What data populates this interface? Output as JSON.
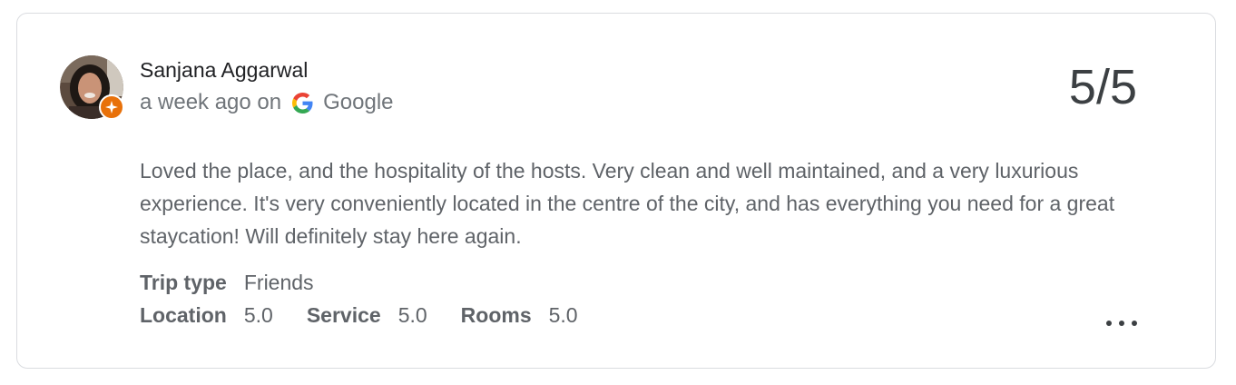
{
  "review": {
    "reviewer_name": "Sanjana Aggarwal",
    "time_ago": "a week ago on",
    "source": "Google",
    "score": "5/5",
    "text": "Loved the place, and the hospitality of the hosts. Very clean and well maintained, and a very luxurious experience. It's very conveniently located in the centre of the city, and has everything you need for a great staycation! Will definitely stay here again.",
    "trip_type_label": "Trip type",
    "trip_type_value": "Friends",
    "ratings": [
      {
        "label": "Location",
        "value": "5.0"
      },
      {
        "label": "Service",
        "value": "5.0"
      },
      {
        "label": "Rooms",
        "value": "5.0"
      }
    ]
  },
  "icons": {
    "avatar": "reviewer-avatar",
    "badge": "local-guide-badge-icon",
    "source_logo": "google-g-icon",
    "more": "more-options-icon"
  },
  "colors": {
    "badge": "#e8710a",
    "score_text": "#3c4043",
    "body_text": "#5f6368",
    "border": "#dadce0"
  }
}
